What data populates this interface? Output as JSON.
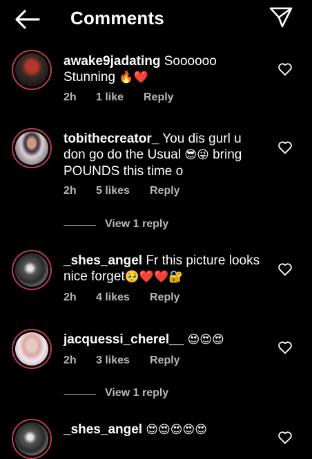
{
  "header": {
    "title": "Comments",
    "back_icon": "arrow-left-icon",
    "send_icon": "paper-plane-icon"
  },
  "comments": [
    {
      "user": "awake9jadating",
      "text": "Soooooo Stunning",
      "emoji": "🔥❤️",
      "time": "2h",
      "likes": "1 like",
      "reply": "Reply"
    },
    {
      "user": "tobithecreator_",
      "text": "You dis gurl u don go do the Usual",
      "emoji_mid": "😎😜",
      "text_after": "bring POUNDS this time o",
      "time": "2h",
      "likes": "5 likes",
      "reply": "Reply",
      "view_replies": "View 1 reply"
    },
    {
      "user": "_shes_angel",
      "text": "Fr this picture looks nice forget",
      "emoji": "🥺❤️❤️🔐",
      "time": "2h",
      "likes": "4 likes",
      "reply": "Reply"
    },
    {
      "user": "jacquessi_cherel__",
      "text": "",
      "emoji": "😍😍😍",
      "time": "2h",
      "likes": "3 likes",
      "reply": "Reply",
      "view_replies": "View 1 reply"
    },
    {
      "user": "_shes_angel",
      "text": "",
      "emoji": "😍😍😍😍😍"
    }
  ],
  "colors": {
    "background": "#000000",
    "text": "#ffffff",
    "meta": "#b8b8b8",
    "avatar_ring": "#c0395a"
  }
}
